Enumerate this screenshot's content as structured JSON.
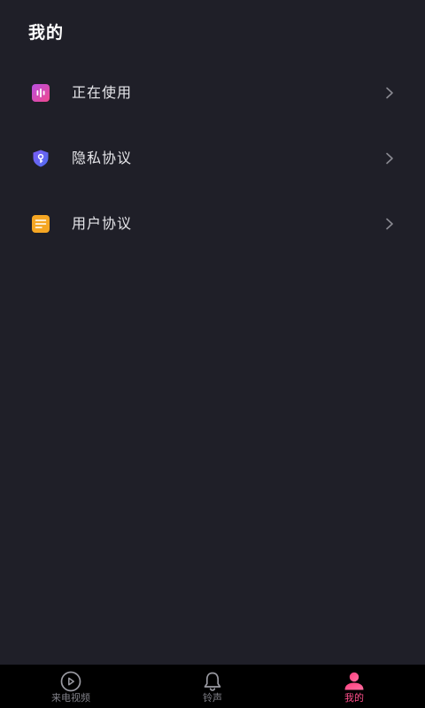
{
  "header": {
    "title": "我的"
  },
  "menu": {
    "items": [
      {
        "label": "正在使用",
        "icon": "equalizer-icon",
        "color": "#d84bd6"
      },
      {
        "label": "隐私协议",
        "icon": "shield-key-icon",
        "color": "#6a5ff2"
      },
      {
        "label": "用户协议",
        "icon": "document-icon",
        "color": "#f5a623"
      }
    ]
  },
  "bottom_nav": {
    "tabs": [
      {
        "label": "来电视频",
        "icon": "play-circle-icon",
        "active": false
      },
      {
        "label": "铃声",
        "icon": "bell-icon",
        "active": false
      },
      {
        "label": "我的",
        "icon": "user-icon",
        "active": true
      }
    ]
  },
  "colors": {
    "background": "#1f1f28",
    "nav_background": "#000000",
    "accent": "#ff4f8b",
    "inactive": "#808088"
  }
}
